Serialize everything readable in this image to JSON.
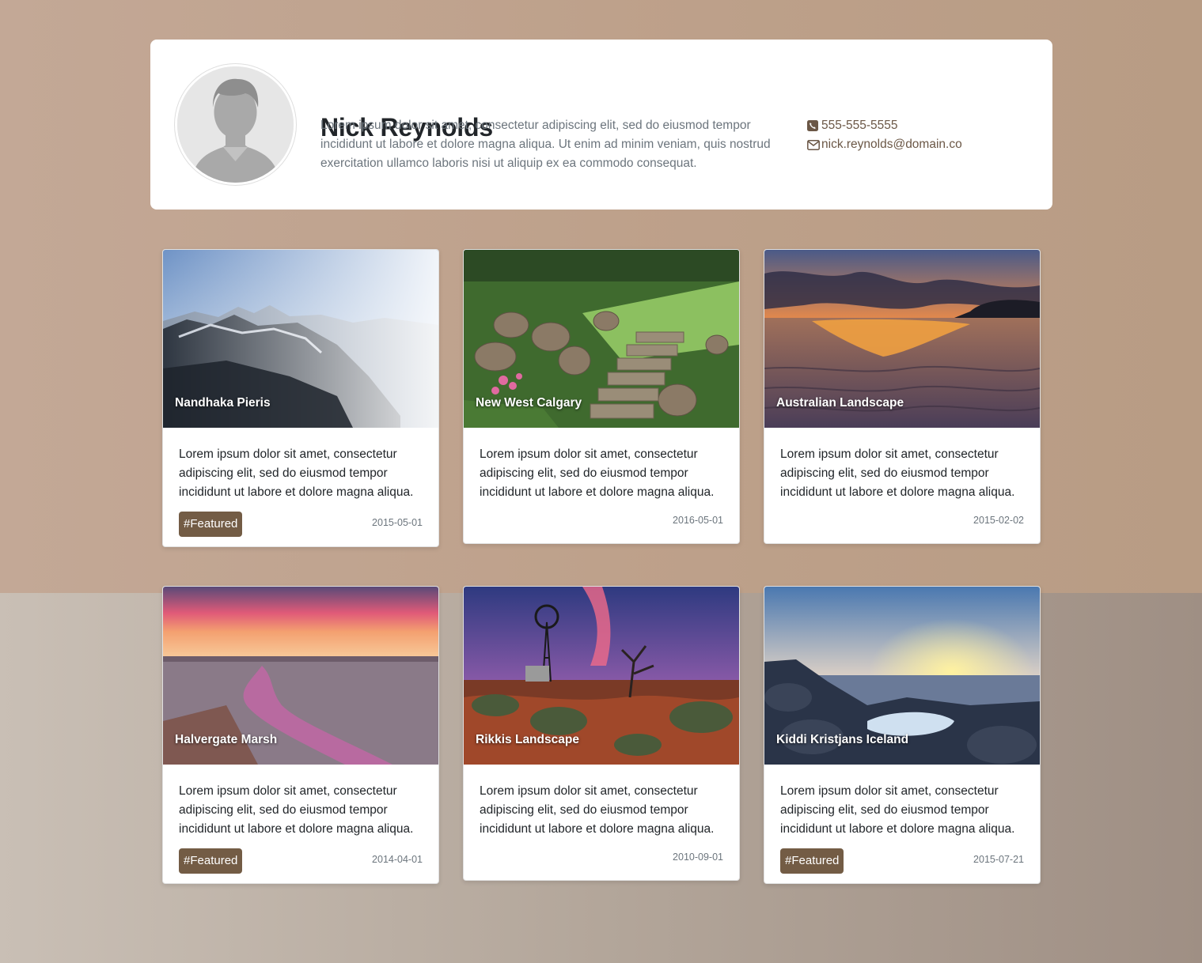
{
  "profile": {
    "name": "Nick Reynolds",
    "bio": "Lorem ipsum dolor sit amet, consectetur adipiscing elit, sed do eiusmod tempor incididunt ut labore et dolore magna aliqua. Ut enim ad minim veniam, quis nostrud exercitation ullamco laboris nisi ut aliquip ex ea commodo consequat.",
    "phone": "555-555-5555",
    "email": "nick.reynolds@domain.co",
    "phone_icon": "phone-square-icon",
    "email_icon": "envelope-icon"
  },
  "cards": [
    {
      "title": "Nandhaka Pieris",
      "text": "Lorem ipsum dolor sit amet, consectetur adipiscing elit, sed do eiusmod tempor incididunt ut labore et dolore magna aliqua.",
      "tag": "#Featured",
      "date": "2015-05-01"
    },
    {
      "title": "New West Calgary",
      "text": "Lorem ipsum dolor sit amet, consectetur adipiscing elit, sed do eiusmod tempor incididunt ut labore et dolore magna aliqua.",
      "tag": "",
      "date": "2016-05-01"
    },
    {
      "title": "Australian Landscape",
      "text": "Lorem ipsum dolor sit amet, consectetur adipiscing elit, sed do eiusmod tempor incididunt ut labore et dolore magna aliqua.",
      "tag": "",
      "date": "2015-02-02"
    },
    {
      "title": "Halvergate Marsh",
      "text": "Lorem ipsum dolor sit amet, consectetur adipiscing elit, sed do eiusmod tempor incididunt ut labore et dolore magna aliqua.",
      "tag": "#Featured",
      "date": "2014-04-01"
    },
    {
      "title": "Rikkis Landscape",
      "text": "Lorem ipsum dolor sit amet, consectetur adipiscing elit, sed do eiusmod tempor incididunt ut labore et dolore magna aliqua.",
      "tag": "",
      "date": "2010-09-01"
    },
    {
      "title": "Kiddi Kristjans Iceland",
      "text": "Lorem ipsum dolor sit amet, consectetur adipiscing elit, sed do eiusmod tempor incididunt ut labore et dolore magna aliqua.",
      "tag": "#Featured",
      "date": "2015-07-21"
    }
  ],
  "colors": {
    "accent": "#735c45",
    "contact_text": "#6b5746",
    "muted": "#6c757d"
  }
}
